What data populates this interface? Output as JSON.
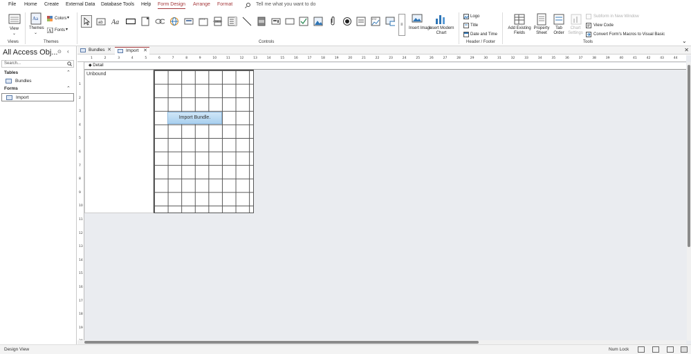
{
  "menu": {
    "items": [
      "File",
      "Home",
      "Create",
      "External Data",
      "Database Tools",
      "Help",
      "Form Design",
      "Arrange",
      "Format"
    ],
    "active": "Form Design",
    "tell_me": "Tell me what you want to do"
  },
  "ribbon": {
    "views": {
      "view_label": "View",
      "group": "Views"
    },
    "themes": {
      "themes_label": "Themes",
      "colors_label": "Colors",
      "fonts_label": "Fonts",
      "group": "Themes"
    },
    "controls": {
      "group": "Controls",
      "insert_image": "Insert Image",
      "insert_chart": "Insert Modern Chart"
    },
    "header_footer": {
      "logo": "Logo",
      "title": "Title",
      "date_time": "Date and Time",
      "group": "Header / Footer"
    },
    "tools": {
      "add_fields": "Add Existing Fields",
      "property_sheet": "Property Sheet",
      "tab_order": "Tab Order",
      "chart_settings": "Chart Settings",
      "subform": "Subform in New Window",
      "view_code": "View Code",
      "convert": "Convert Form's Macros to Visual Basic",
      "group": "Tools"
    }
  },
  "nav": {
    "title": "All Access Obj...",
    "search_placeholder": "Search...",
    "sections": [
      {
        "label": "Tables",
        "items": [
          "Bundles"
        ]
      },
      {
        "label": "Forms",
        "items": [
          "Import"
        ]
      }
    ]
  },
  "tabs": [
    {
      "label": "Bundles",
      "active": false
    },
    {
      "label": "Import",
      "active": true
    }
  ],
  "design": {
    "section": "Detail",
    "unbound_label": "Unbound",
    "button_label": "Import Bundle.",
    "ruler_h": [
      "1",
      "2",
      "3",
      "4",
      "5",
      "6",
      "7",
      "8",
      "9",
      "10",
      "11",
      "12",
      "13",
      "14",
      "15",
      "16",
      "17",
      "18",
      "19",
      "20",
      "21",
      "22",
      "23",
      "24",
      "25",
      "26",
      "27",
      "28",
      "29",
      "30",
      "31",
      "32",
      "33",
      "34",
      "35",
      "36",
      "37",
      "38",
      "39",
      "40",
      "41",
      "42",
      "43",
      "44"
    ],
    "ruler_v": [
      "1",
      "2",
      "3",
      "4",
      "5",
      "6",
      "7",
      "8",
      "9",
      "10",
      "11",
      "12",
      "13",
      "14",
      "15",
      "16",
      "17",
      "18",
      "19",
      "20"
    ]
  },
  "status": {
    "left": "Design View",
    "num_lock": "Num Lock"
  },
  "colors": {
    "accent": "#a4373a",
    "button": "#a9d0ef"
  }
}
